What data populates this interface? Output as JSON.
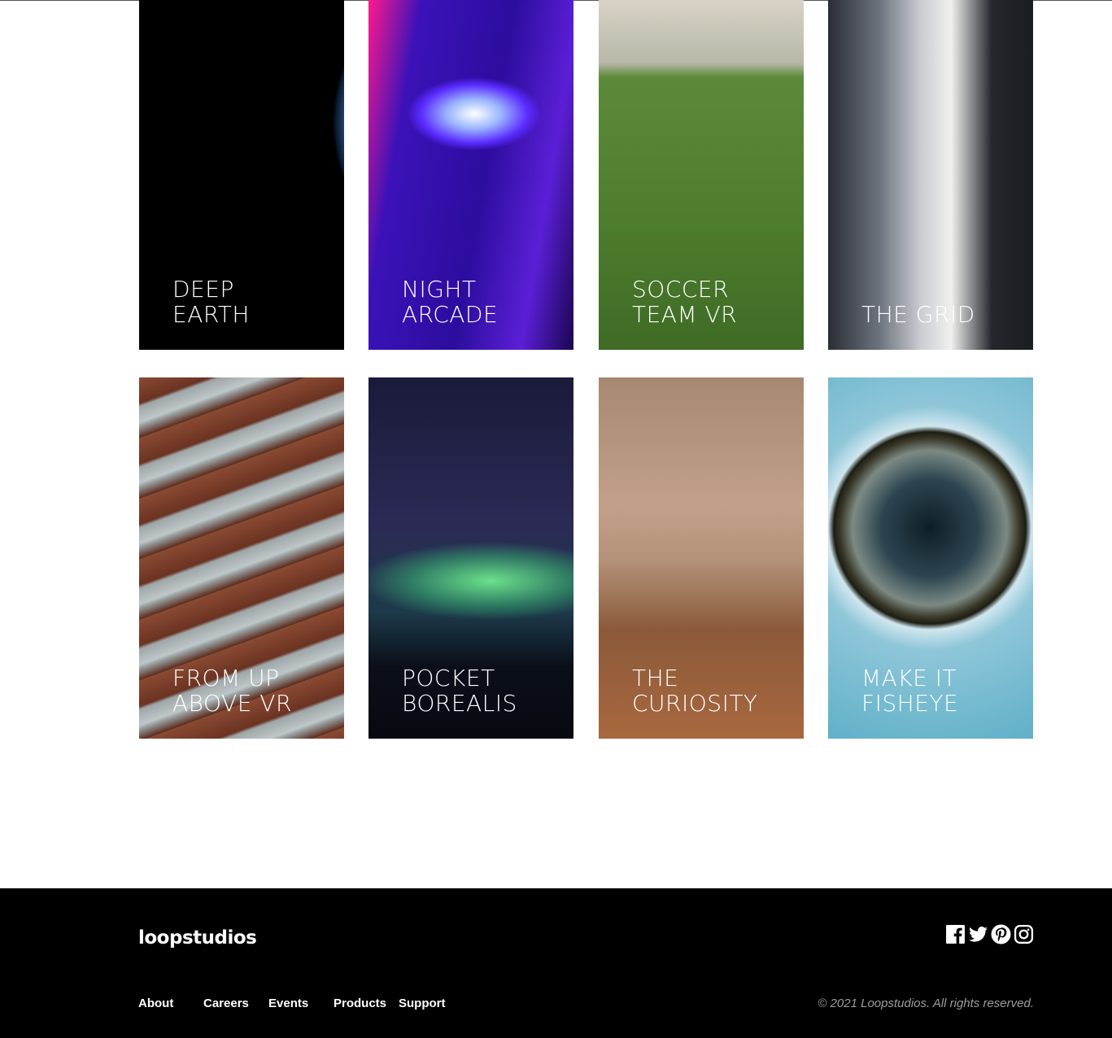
{
  "gallery": {
    "cards": [
      {
        "title": "Deep\nEarth"
      },
      {
        "title": "Night\nArcade"
      },
      {
        "title": "Soccer\nTeam VR"
      },
      {
        "title": "The Grid"
      },
      {
        "title": "From Up\nAbove VR"
      },
      {
        "title": "Pocket\nBorealis"
      },
      {
        "title": "The\nCuriosity"
      },
      {
        "title": "Make it\nFisheye"
      }
    ]
  },
  "footer": {
    "logo": "loopstudios",
    "nav": [
      "About",
      "Careers",
      "Events",
      "Products",
      "Support"
    ],
    "social": [
      "facebook-icon",
      "twitter-icon",
      "pinterest-icon",
      "instagram-icon"
    ],
    "copyright": "© 2021 Loopstudios. All rights reserved."
  }
}
